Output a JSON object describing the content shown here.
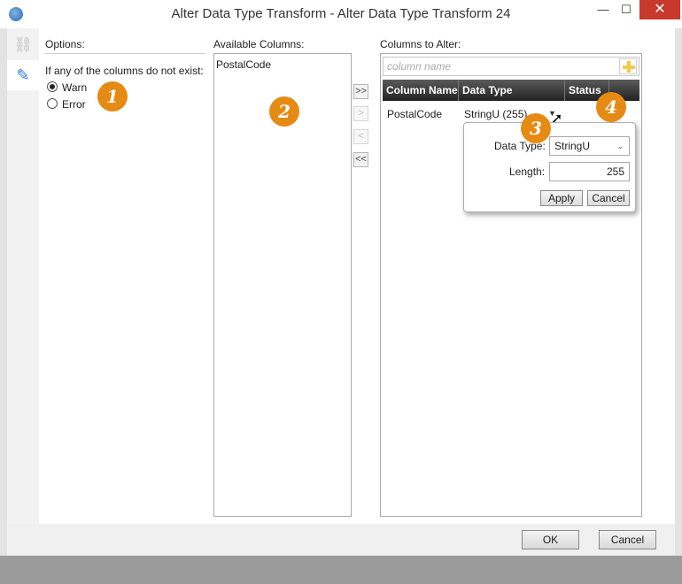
{
  "window": {
    "title": "Alter Data Type Transform - Alter Data Type Transform 24",
    "minimize": "—",
    "maximize": "☐",
    "close": "✕"
  },
  "rail": {
    "link_icon": "link-icon",
    "edit_icon": "pencil-icon"
  },
  "options": {
    "heading": "Options:",
    "prompt": "If any of the columns do not exist:",
    "radios": [
      {
        "label": "Warn",
        "selected": true
      },
      {
        "label": "Error",
        "selected": false
      }
    ]
  },
  "available": {
    "heading": "Available Columns:",
    "items": [
      "PostalCode"
    ]
  },
  "move_buttons": {
    "add_all": ">>",
    "add": ">",
    "remove": "<",
    "remove_all": "<<"
  },
  "alter": {
    "heading": "Columns to Alter:",
    "search_placeholder": "column name",
    "columns": [
      "Column Name",
      "Data Type",
      "Status"
    ],
    "rows": [
      {
        "name": "PostalCode",
        "type": "StringU (255)",
        "status": ""
      }
    ]
  },
  "popup": {
    "data_type_label": "Data Type:",
    "data_type_value": "StringU",
    "length_label": "Length:",
    "length_value": "255",
    "apply": "Apply",
    "cancel": "Cancel"
  },
  "badges": [
    "1",
    "2",
    "3",
    "4"
  ],
  "footer": {
    "ok": "OK",
    "cancel": "Cancel"
  },
  "colors": {
    "accent": "#2a7bd4",
    "badge": "#e58a12",
    "close": "#c7392b"
  }
}
